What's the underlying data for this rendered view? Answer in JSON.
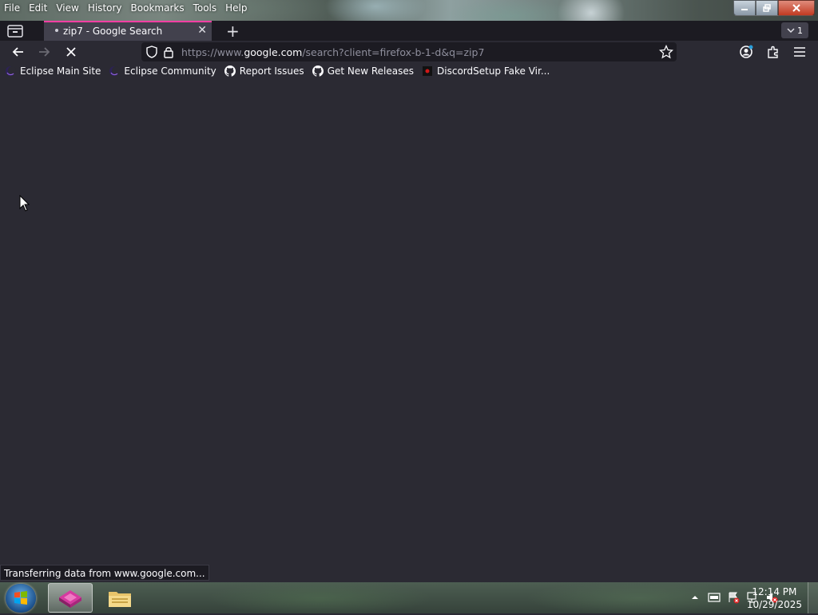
{
  "menu": [
    "File",
    "Edit",
    "View",
    "History",
    "Bookmarks",
    "Tools",
    "Help"
  ],
  "tab": {
    "title": "zip7 - Google Search",
    "close_glyph": "✕"
  },
  "tabs_count": "1",
  "url": {
    "prefix": "https://www.",
    "domain": "google.com",
    "suffix": "/search?client=firefox-b-1-d&q=zip7"
  },
  "bookmarks": [
    {
      "label": "Eclipse Main Site",
      "icon": "eclipse-icon"
    },
    {
      "label": "Eclipse Community",
      "icon": "eclipse-icon"
    },
    {
      "label": "Report Issues",
      "icon": "github-icon"
    },
    {
      "label": "Get New Releases",
      "icon": "github-icon"
    },
    {
      "label": "DiscordSetup Fake Vir...",
      "icon": "red-icon"
    }
  ],
  "status_text": "Transferring data from www.google.com...",
  "clock": {
    "time": "12:14 PM",
    "date": "10/29/2025"
  },
  "colors": {
    "accent": "#ff3fa4",
    "toolbar": "#2b2a33",
    "urlbar": "#1c1b22"
  }
}
